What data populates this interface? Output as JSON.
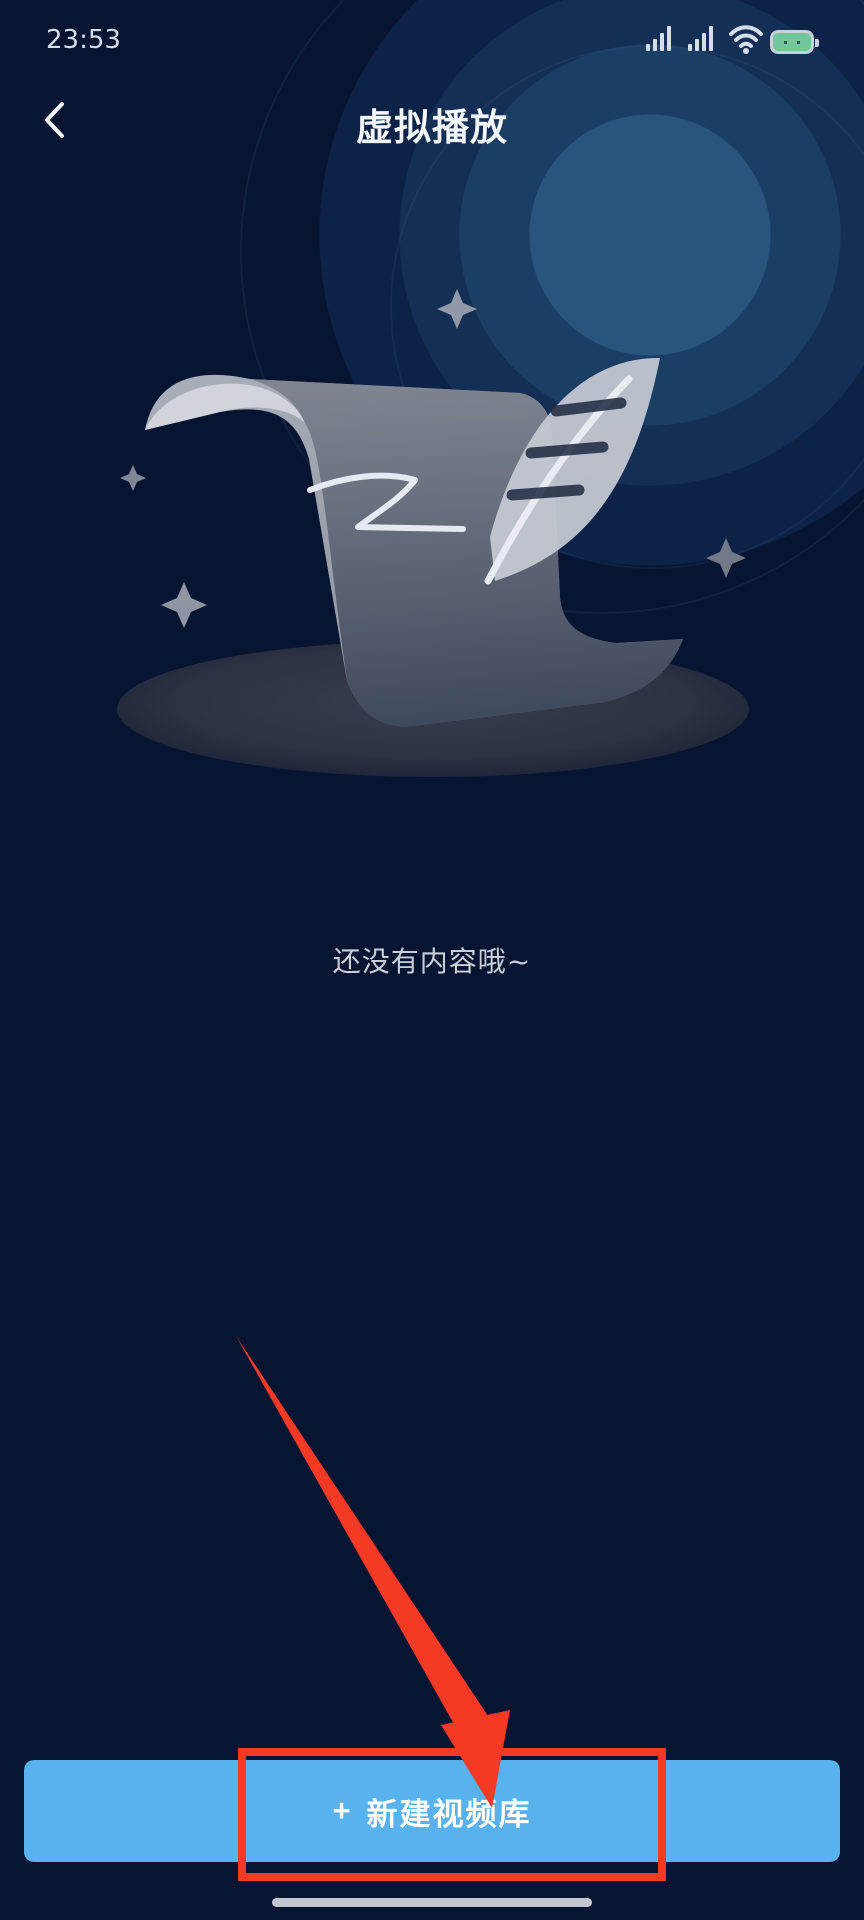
{
  "status_bar": {
    "time": "23:53",
    "icons": [
      "signal-icon",
      "signal-icon",
      "wifi-icon",
      "battery-icon"
    ]
  },
  "nav": {
    "title": "虚拟播放",
    "back_icon": "chevron-left-icon"
  },
  "empty_state": {
    "message": "还没有内容哦~",
    "illustration_icon": "scroll-and-quill-icon"
  },
  "primary_action": {
    "icon": "+",
    "label": "新建视频库"
  },
  "colors": {
    "background": "#071533",
    "button": "#57b2ee",
    "annotation": "#f43a24"
  }
}
